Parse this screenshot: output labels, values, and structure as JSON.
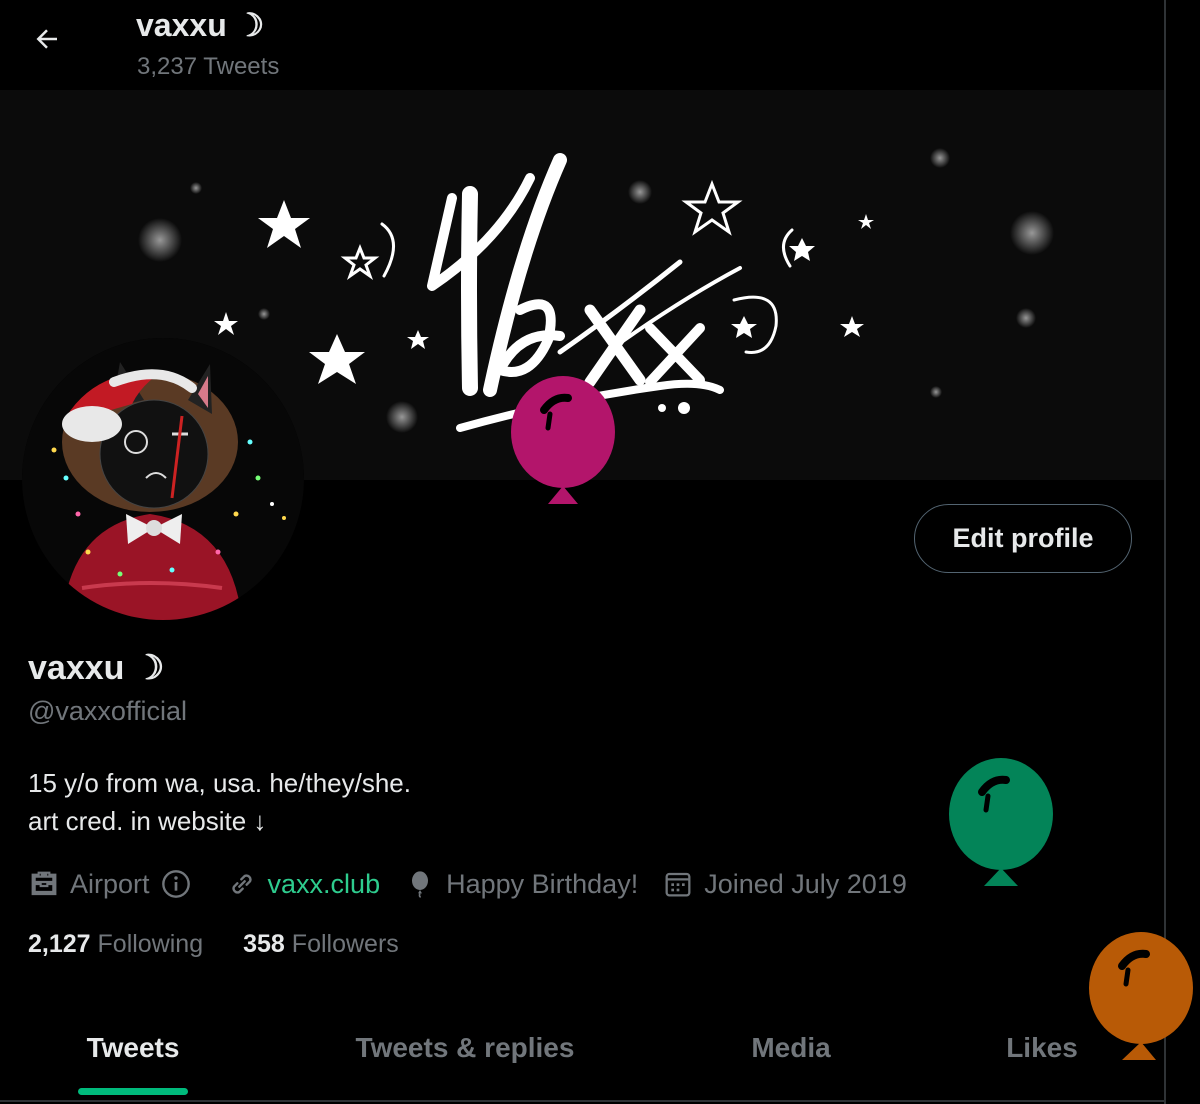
{
  "header": {
    "title": "vaxxu ☽",
    "tweet_count": "3,237 Tweets"
  },
  "banner": {
    "logo_text": "Vaxx"
  },
  "profile": {
    "display_name": "vaxxu ☽",
    "handle": "@vaxxofficial",
    "bio_line_1": "15 y/o from wa, usa. he/they/she.",
    "bio_line_2": "art cred. in website ↓",
    "edit_label": "Edit profile"
  },
  "meta": {
    "location": "Airport",
    "website": "vaxx.club",
    "birthday": "Happy Birthday!",
    "joined": "Joined July 2019"
  },
  "stats": {
    "following_count": "2,127",
    "following_label": "Following",
    "followers_count": "358",
    "followers_label": "Followers"
  },
  "tabs": {
    "tweets": "Tweets",
    "replies": "Tweets & replies",
    "media": "Media",
    "likes": "Likes"
  },
  "colors": {
    "accent": "#00ba7c",
    "link": "#2ecc8e",
    "balloon_pink": "#b3156b",
    "balloon_green": "#038458",
    "balloon_orange": "#b85a06"
  }
}
